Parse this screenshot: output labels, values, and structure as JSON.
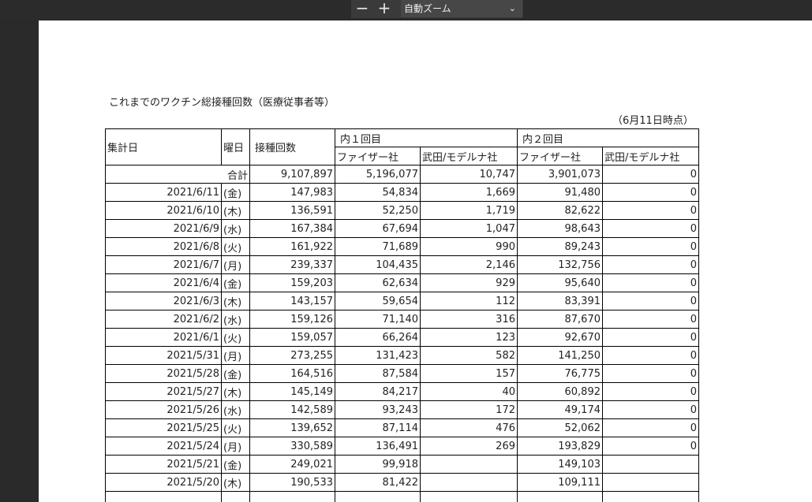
{
  "toolbar": {
    "zoom_out_label": "−",
    "zoom_in_label": "+",
    "zoom_value": "自動ズーム",
    "chevron": "⌄"
  },
  "document": {
    "title": "これまでのワクチン総接種回数（医療従事者等）",
    "as_of": "（6月11日時点）",
    "headers": {
      "date": "集計日",
      "weekday": "曜日",
      "total": "接種回数",
      "dose1": "内１回目",
      "dose2": "内２回目",
      "pfizer": "ファイザー社",
      "moderna": "武田/モデルナ社"
    },
    "total_row": {
      "label": "合計",
      "total": "9,107,897",
      "d1_pfizer": "5,196,077",
      "d1_moderna": "10,747",
      "d2_pfizer": "3,901,073",
      "d2_moderna": "0"
    },
    "rows": [
      {
        "date": "2021/6/11",
        "dow": "(金)",
        "total": "147,983",
        "d1p": "54,834",
        "d1m": "1,669",
        "d2p": "91,480",
        "d2m": "0"
      },
      {
        "date": "2021/6/10",
        "dow": "(木)",
        "total": "136,591",
        "d1p": "52,250",
        "d1m": "1,719",
        "d2p": "82,622",
        "d2m": "0"
      },
      {
        "date": "2021/6/9",
        "dow": "(水)",
        "total": "167,384",
        "d1p": "67,694",
        "d1m": "1,047",
        "d2p": "98,643",
        "d2m": "0"
      },
      {
        "date": "2021/6/8",
        "dow": "(火)",
        "total": "161,922",
        "d1p": "71,689",
        "d1m": "990",
        "d2p": "89,243",
        "d2m": "0"
      },
      {
        "date": "2021/6/7",
        "dow": "(月)",
        "total": "239,337",
        "d1p": "104,435",
        "d1m": "2,146",
        "d2p": "132,756",
        "d2m": "0"
      },
      {
        "date": "2021/6/4",
        "dow": "(金)",
        "total": "159,203",
        "d1p": "62,634",
        "d1m": "929",
        "d2p": "95,640",
        "d2m": "0"
      },
      {
        "date": "2021/6/3",
        "dow": "(木)",
        "total": "143,157",
        "d1p": "59,654",
        "d1m": "112",
        "d2p": "83,391",
        "d2m": "0"
      },
      {
        "date": "2021/6/2",
        "dow": "(水)",
        "total": "159,126",
        "d1p": "71,140",
        "d1m": "316",
        "d2p": "87,670",
        "d2m": "0"
      },
      {
        "date": "2021/6/1",
        "dow": "(火)",
        "total": "159,057",
        "d1p": "66,264",
        "d1m": "123",
        "d2p": "92,670",
        "d2m": "0"
      },
      {
        "date": "2021/5/31",
        "dow": "(月)",
        "total": "273,255",
        "d1p": "131,423",
        "d1m": "582",
        "d2p": "141,250",
        "d2m": "0"
      },
      {
        "date": "2021/5/28",
        "dow": "(金)",
        "total": "164,516",
        "d1p": "87,584",
        "d1m": "157",
        "d2p": "76,775",
        "d2m": "0"
      },
      {
        "date": "2021/5/27",
        "dow": "(木)",
        "total": "145,149",
        "d1p": "84,217",
        "d1m": "40",
        "d2p": "60,892",
        "d2m": "0"
      },
      {
        "date": "2021/5/26",
        "dow": "(水)",
        "total": "142,589",
        "d1p": "93,243",
        "d1m": "172",
        "d2p": "49,174",
        "d2m": "0"
      },
      {
        "date": "2021/5/25",
        "dow": "(火)",
        "total": "139,652",
        "d1p": "87,114",
        "d1m": "476",
        "d2p": "52,062",
        "d2m": "0"
      },
      {
        "date": "2021/5/24",
        "dow": "(月)",
        "total": "330,589",
        "d1p": "136,491",
        "d1m": "269",
        "d2p": "193,829",
        "d2m": "0"
      },
      {
        "date": "2021/5/21",
        "dow": "(金)",
        "total": "249,021",
        "d1p": "99,918",
        "d1m": "",
        "d2p": "149,103",
        "d2m": ""
      },
      {
        "date": "2021/5/20",
        "dow": "(木)",
        "total": "190,533",
        "d1p": "81,422",
        "d1m": "",
        "d2p": "109,111",
        "d2m": ""
      },
      {
        "date": "",
        "dow": "",
        "total": "",
        "d1p": "",
        "d1m": "",
        "d2p": "",
        "d2m": ""
      }
    ]
  }
}
